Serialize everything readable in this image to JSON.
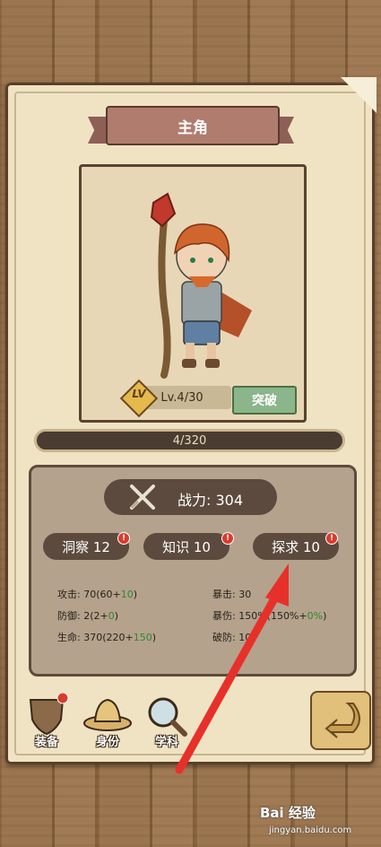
{
  "header": {
    "title": "主角"
  },
  "hero": {
    "lv_badge": "LV",
    "level": "Lv.4/30",
    "break_label": "突破",
    "xp": "4/320"
  },
  "stats": {
    "power": "战力: 304",
    "attack_base": "攻击: 70(60+",
    "attack_bonus": "10",
    "attack_close": ")",
    "defense_base": "防御: 2(2+",
    "defense_bonus": "0",
    "defense_close": ")",
    "hp_base": "生命: 370(220+",
    "hp_bonus": "150",
    "hp_close": ")",
    "crit": "暴击: 30",
    "critdmg_base": "暴伤: 150%(150%+",
    "critdmg_bonus": "0%",
    "critdmg_close": ")",
    "armorbreak": "破防: 10"
  },
  "attributes": [
    "洞察 12",
    "知识 10",
    "探求 10"
  ],
  "bottom_nav": [
    "装备",
    "身份",
    "学科"
  ],
  "watermark": {
    "logo": "Bai 经验",
    "url": "jingyan.baidu.com"
  },
  "colors": {
    "parchment": "#efe3c4",
    "panel": "#b4a28c",
    "pill": "#5b4a3d",
    "break_button": "#8bb58a",
    "arrow": "#e8302a",
    "bonus_green": "#2c8a2c"
  }
}
